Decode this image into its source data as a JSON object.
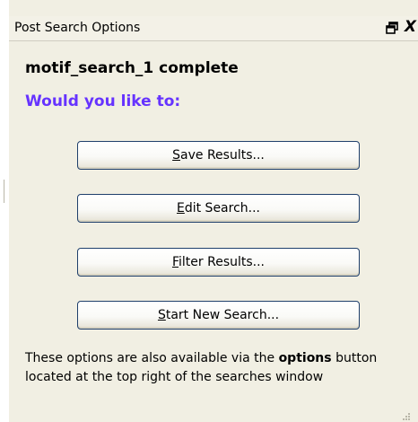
{
  "window": {
    "title": "Post Search Options",
    "close_glyph": "X"
  },
  "main": {
    "heading": "motif_search_1 complete",
    "subheading": "Would you like to:",
    "accent_color": "#6633ff"
  },
  "buttons": [
    {
      "mnemonic": "S",
      "rest": "ave Results..."
    },
    {
      "mnemonic": "E",
      "rest": "dit Search..."
    },
    {
      "mnemonic": "F",
      "rest": "ilter Results..."
    },
    {
      "mnemonic": "S",
      "rest": "tart New Search..."
    }
  ],
  "footnote": {
    "before": "These options are also available via the ",
    "bold": "options",
    "after": " button located at the top right of the searches window"
  },
  "icons": {
    "float": "float-window-icon",
    "close": "close-icon",
    "grip": "resize-grip-icon"
  }
}
